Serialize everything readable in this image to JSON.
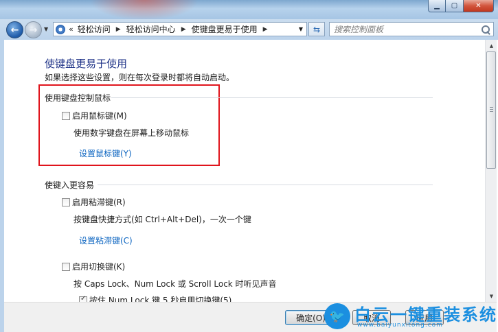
{
  "window": {
    "min_icon": "minimize-icon",
    "max_icon": "maximize-icon",
    "close_glyph": "✕"
  },
  "address": {
    "overflow": "«",
    "crumbs": [
      "轻松访问",
      "轻松访问中心",
      "使键盘更易于使用"
    ]
  },
  "search": {
    "placeholder": "搜索控制面板"
  },
  "page": {
    "heading": "使键盘更易于使用",
    "subtitle": "如果选择这些设置，则在每次登录时都将自动启动。"
  },
  "mouse_section": {
    "title": "使用键盘控制鼠标",
    "checkbox_label": "启用鼠标键(M)",
    "checked": false,
    "description": "使用数字键盘在屏幕上移动鼠标",
    "link": "设置鼠标键(Y)"
  },
  "typing_section": {
    "title": "使键入更容易",
    "sticky_label": "启用粘滞键(R)",
    "sticky_checked": false,
    "sticky_description": "按键盘快捷方式(如 Ctrl+Alt+Del)，一次一个键",
    "sticky_link": "设置粘滞键(C)",
    "toggle_label": "启用切换键(K)",
    "toggle_checked": false,
    "toggle_description": "按 Caps Lock、Num Lock 或 Scroll Lock 时听见声音",
    "toggle_sub_label": "按住 Num Lock 键 5 秒启用切换键(5)",
    "toggle_sub_checked": true
  },
  "buttons": {
    "ok": "确定(O)",
    "cancel": "取消",
    "apply": "应用"
  },
  "watermark": {
    "text": "白云一键重装系统",
    "url": "www.baiyunxitong.com"
  },
  "colors": {
    "heading": "#1e3287",
    "link": "#0b64c0",
    "highlight_border": "#e0141c",
    "watermark": "#1b8fe0"
  }
}
